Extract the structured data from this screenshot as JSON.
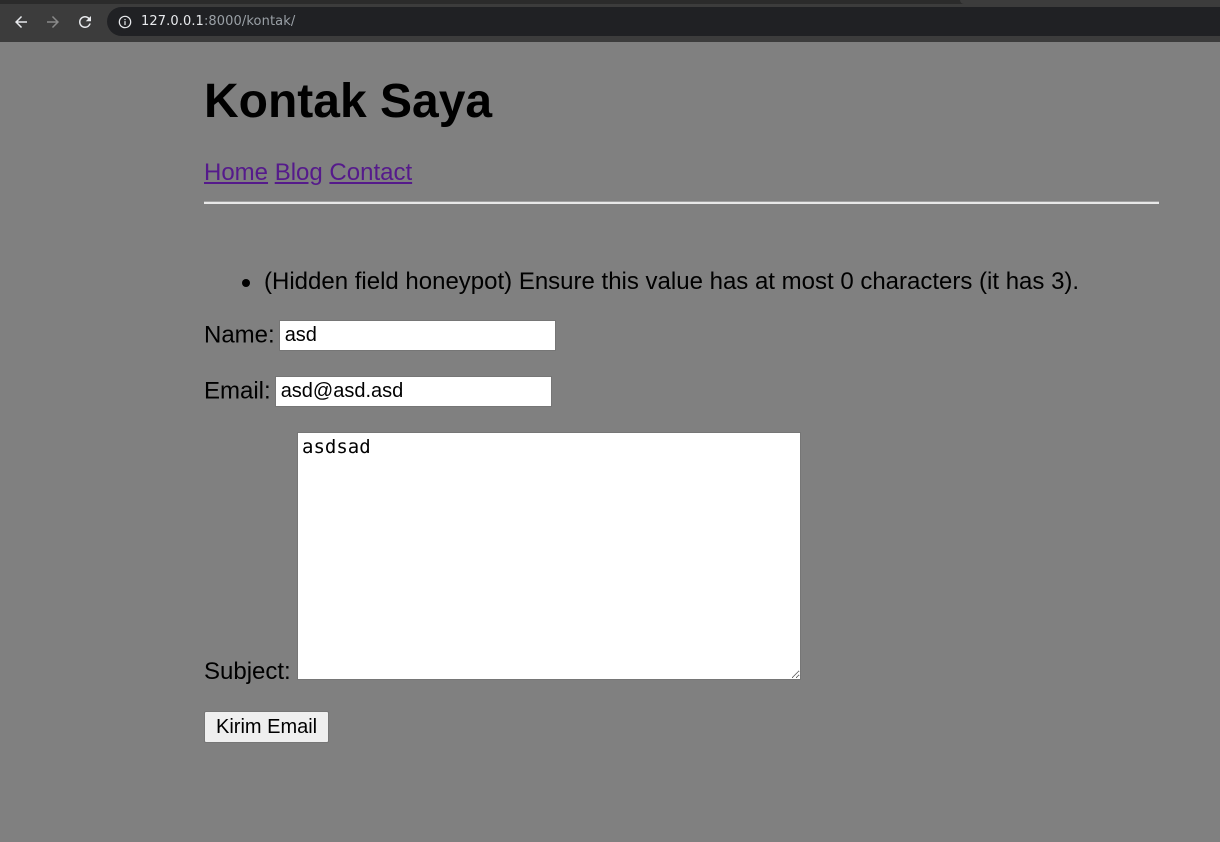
{
  "browser": {
    "url_host": "127.0.0.1",
    "url_rest": ":8000/kontak/",
    "icons": [
      "back-arrow-icon",
      "forward-arrow-icon",
      "reload-icon",
      "info-icon"
    ]
  },
  "page": {
    "title": "Kontak Saya",
    "nav": {
      "home": "Home",
      "blog": "Blog",
      "contact": "Contact"
    },
    "errors": [
      "(Hidden field honeypot) Ensure this value has at most 0 characters (it has 3)."
    ],
    "form": {
      "name_label": "Name:",
      "name_value": "asd",
      "email_label": "Email:",
      "email_value": "asd@asd.asd",
      "subject_label": "Subject:",
      "subject_value": "asdsad",
      "submit_label": "Kirim Email"
    }
  },
  "colors": {
    "page_background": "#808080",
    "visited_link": "#551a8b"
  }
}
